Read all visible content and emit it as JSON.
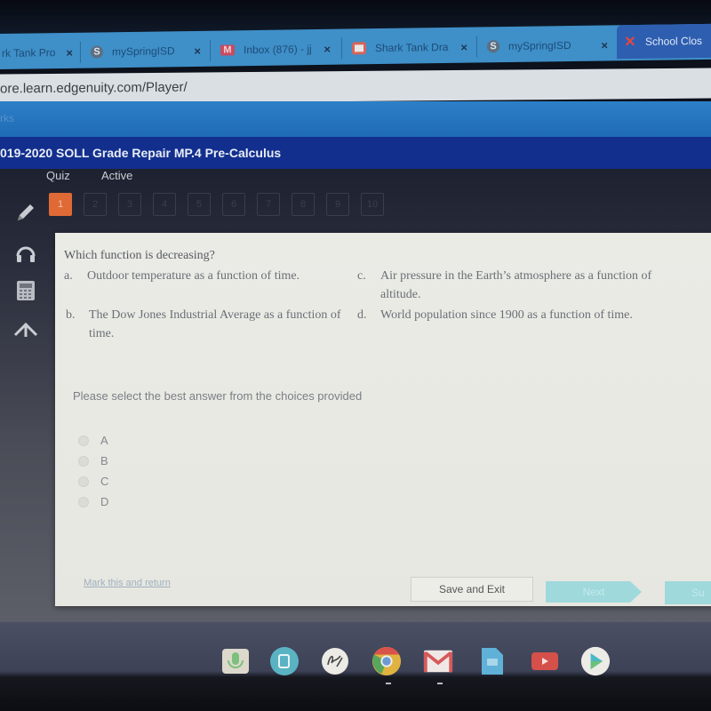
{
  "browser": {
    "tabs": [
      {
        "label": "rk Tank Pro",
        "icon": "page-icon",
        "active": false
      },
      {
        "label": "mySpringISD",
        "icon": "springisd-logo-icon",
        "active": false
      },
      {
        "label": "Inbox (876) - jj",
        "icon": "gmail-icon",
        "active": false
      },
      {
        "label": "Shark Tank Dra",
        "icon": "slides-icon",
        "active": false
      },
      {
        "label": "mySpringISD",
        "icon": "springisd-logo-icon",
        "active": false
      },
      {
        "label": "School Clos",
        "icon": "x-brand-icon",
        "active": true
      }
    ],
    "close_glyph": "×",
    "url": "ore.learn.edgenuity.com/Player/",
    "bookmarks_label": "rks"
  },
  "course": {
    "title": "019-2020 SOLL Grade Repair MP.4 Pre-Calculus",
    "activity_type": "Quiz",
    "status": "Active"
  },
  "question_nav": {
    "numbers": [
      "1",
      "2",
      "3",
      "4",
      "5",
      "6",
      "7",
      "8",
      "9",
      "10"
    ],
    "current": "1"
  },
  "tools": [
    {
      "name": "pencil-icon"
    },
    {
      "name": "headphones-icon"
    },
    {
      "name": "calculator-icon"
    },
    {
      "name": "collapse-up-icon"
    }
  ],
  "question": {
    "stem": "Which function is decreasing?",
    "options": [
      {
        "letter": "a.",
        "text": "Outdoor temperature as a function of time."
      },
      {
        "letter": "b.",
        "text": "The Dow Jones Industrial Average as a function of time."
      },
      {
        "letter": "c.",
        "text": "Air pressure in the Earth’s atmosphere as a function of altitude."
      },
      {
        "letter": "d.",
        "text": "World population since 1900 as a function of time."
      }
    ],
    "instruction": "Please select the best answer from the choices provided",
    "choices": [
      "A",
      "B",
      "C",
      "D"
    ],
    "selected": null
  },
  "footer": {
    "mark_link": "Mark this and return",
    "save_exit": "Save and Exit",
    "next": "Next",
    "submit": "Su"
  },
  "shelf": {
    "apps": [
      "voice-recorder-icon",
      "screencast-icon",
      "signature-icon",
      "chrome-icon",
      "gmail-icon",
      "docs-icon",
      "youtube-icon",
      "play-store-icon"
    ]
  },
  "colors": {
    "accent_current_question": "#e06a35",
    "tabstrip": "#3f8fc8",
    "course_header": "#122f8e",
    "next_button": "#9fd9dc"
  }
}
